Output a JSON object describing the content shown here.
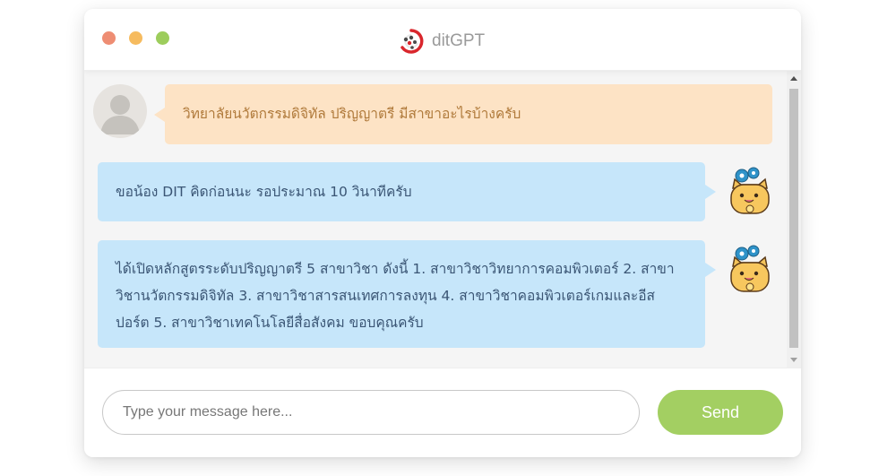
{
  "window": {
    "title": "ditGPT",
    "controls": [
      "close",
      "minimize",
      "maximize"
    ],
    "control_colors": {
      "close": "#ee8d73",
      "minimize": "#f6bb5f",
      "maximize": "#9dcd5c"
    },
    "logo_icon": "ditgpt-logo-icon"
  },
  "messages": [
    {
      "sender": "user",
      "avatar": "user-avatar-icon",
      "text": "วิทยาลัยนวัตกรรมดิจิทัล ปริญญาตรี มีสาขาอะไรบ้างครับ",
      "color": "#fde3c5"
    },
    {
      "sender": "bot",
      "avatar": "cat-mascot-icon",
      "text": "ขอน้อง DIT คิดก่อนนะ รอประมาณ 10 วินาทีครับ",
      "color": "#c6e6fa"
    },
    {
      "sender": "bot",
      "avatar": "cat-mascot-icon",
      "text": "ได้เปิดหลักสูตรระดับปริญญาตรี 5 สาขาวิชา ดังนี้ 1. สาขาวิชาวิทยาการคอมพิวเตอร์ 2. สาขาวิชานวัตกรรมดิจิทัล 3. สาขาวิชาสารสนเทศการลงทุน 4. สาขาวิชาคอมพิวเตอร์เกมและอีสปอร์ต 5. สาขาวิชาเทคโนโลยีสื่อสังคม ขอบคุณครับ",
      "color": "#c6e6fa"
    }
  ],
  "composer": {
    "placeholder": "Type your message here...",
    "value": "",
    "send_label": "Send",
    "send_color": "#a3cf62"
  }
}
